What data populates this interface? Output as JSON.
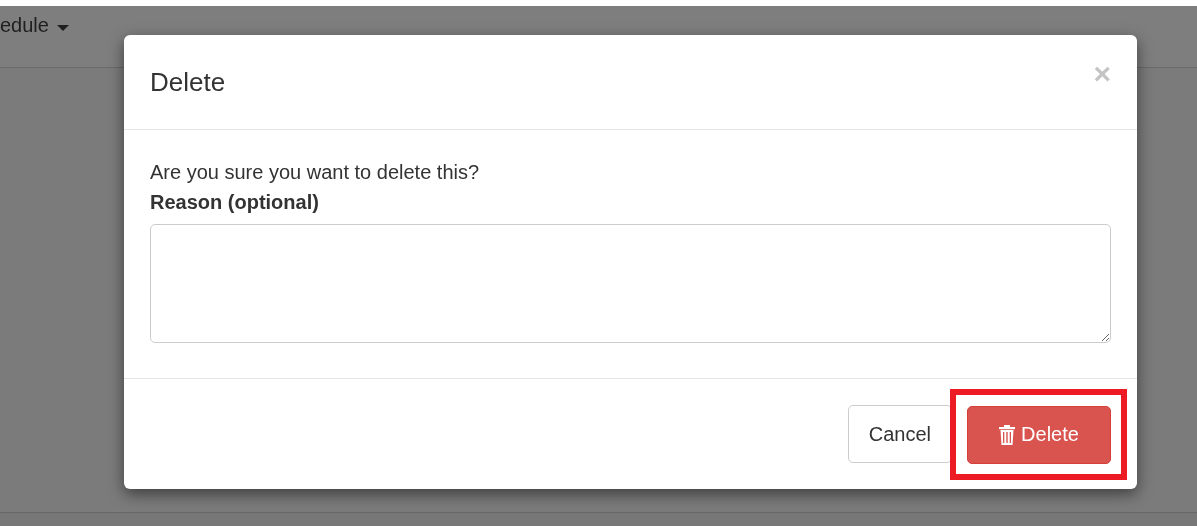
{
  "background_nav": {
    "menu_label": "edule"
  },
  "dialog": {
    "title": "Delete",
    "close": "×",
    "message": "Are you sure you want to delete this?",
    "field_label": "Reason (optional)",
    "buttons": [
      {
        "kind": "default",
        "label": "Cancel",
        "highlighted": false
      },
      {
        "kind": "danger",
        "label": "Delete",
        "highlighted": true
      }
    ]
  }
}
